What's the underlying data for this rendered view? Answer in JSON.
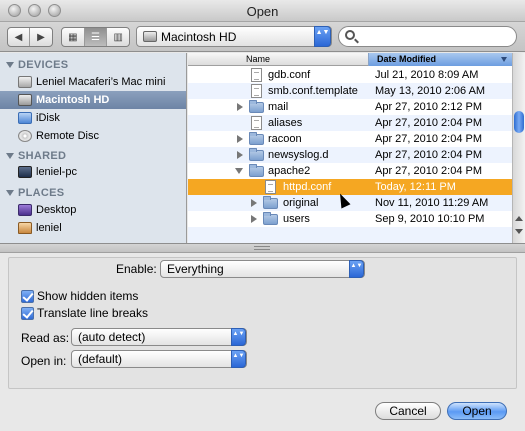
{
  "window": {
    "title": "Open"
  },
  "toolbar": {
    "back_glyph": "◀",
    "forward_glyph": "▶",
    "view_icon_glyph": "▦",
    "view_list_glyph": "☰",
    "view_column_glyph": "▥",
    "location": "Macintosh HD",
    "search_value": ""
  },
  "sidebar": {
    "sections": [
      {
        "title": "DEVICES",
        "items": [
          {
            "label": "Leniel Macaferi’s Mac mini",
            "icon": "computer-icon",
            "selected": false
          },
          {
            "label": "Macintosh HD",
            "icon": "hard-drive-icon",
            "selected": true
          },
          {
            "label": "iDisk",
            "icon": "idisk-icon",
            "selected": false
          },
          {
            "label": "Remote Disc",
            "icon": "remote-disc-icon",
            "selected": false
          }
        ]
      },
      {
        "title": "SHARED",
        "items": [
          {
            "label": "leniel-pc",
            "icon": "network-computer-icon",
            "selected": false
          }
        ]
      },
      {
        "title": "PLACES",
        "items": [
          {
            "label": "Desktop",
            "icon": "desktop-icon",
            "selected": false
          },
          {
            "label": "leniel",
            "icon": "home-icon",
            "selected": false
          }
        ]
      }
    ]
  },
  "filelist": {
    "columns": {
      "name": "Name",
      "date": "Date Modified"
    },
    "rows": [
      {
        "name": "gdb.conf",
        "date": "Jul 21, 2010 8:09 AM",
        "kind": "file",
        "indent": 0,
        "disclosure": "none",
        "selected": false
      },
      {
        "name": "smb.conf.template",
        "date": "May 13, 2010 2:06 AM",
        "kind": "file",
        "indent": 0,
        "disclosure": "none",
        "selected": false
      },
      {
        "name": "mail",
        "date": "Apr 27, 2010 2:12 PM",
        "kind": "folder",
        "indent": 0,
        "disclosure": "collapsed",
        "selected": false
      },
      {
        "name": "aliases",
        "date": "Apr 27, 2010 2:04 PM",
        "kind": "file",
        "indent": 0,
        "disclosure": "none",
        "selected": false
      },
      {
        "name": "racoon",
        "date": "Apr 27, 2010 2:04 PM",
        "kind": "folder",
        "indent": 0,
        "disclosure": "collapsed",
        "selected": false
      },
      {
        "name": "newsyslog.d",
        "date": "Apr 27, 2010 2:04 PM",
        "kind": "folder",
        "indent": 0,
        "disclosure": "collapsed",
        "selected": false
      },
      {
        "name": "apache2",
        "date": "Apr 27, 2010 2:04 PM",
        "kind": "folder",
        "indent": 0,
        "disclosure": "expanded",
        "selected": false
      },
      {
        "name": "httpd.conf",
        "date": "Today, 12:11 PM",
        "kind": "file",
        "indent": 1,
        "disclosure": "none",
        "selected": true
      },
      {
        "name": "original",
        "date": "Nov 11, 2010 11:29 AM",
        "kind": "folder",
        "indent": 1,
        "disclosure": "collapsed",
        "selected": false
      },
      {
        "name": "users",
        "date": "Sep 9, 2010 10:10 PM",
        "kind": "folder",
        "indent": 1,
        "disclosure": "collapsed",
        "selected": false
      }
    ]
  },
  "options": {
    "enable_label": "Enable:",
    "enable_value": "Everything",
    "show_hidden_label": "Show hidden items",
    "show_hidden_checked": true,
    "translate_breaks_label": "Translate line breaks",
    "translate_breaks_checked": true,
    "read_as_label": "Read as:",
    "read_as_value": "(auto detect)",
    "open_in_label": "Open in:",
    "open_in_value": "(default)"
  },
  "buttons": {
    "cancel": "Cancel",
    "open": "Open"
  },
  "popup_arrow_glyph": "▲▼"
}
